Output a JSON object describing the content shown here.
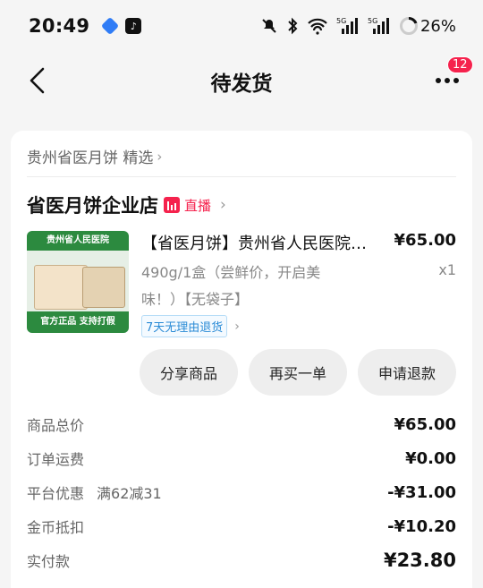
{
  "status_bar": {
    "time": "20:49",
    "battery": "26%"
  },
  "nav": {
    "title": "待发货",
    "badge": "12"
  },
  "order": {
    "breadcrumb": "贵州省医月饼 精选",
    "shop_name": "省医月饼企业店",
    "live_label": "直播",
    "product": {
      "title": "【省医月饼】贵州省人民医院…",
      "price": "¥65.00",
      "spec": "490g/1盒（尝鲜价，开启美味！）【无袋子】",
      "qty": "x1",
      "tag": "7天无理由退货",
      "thumb_top": "贵州省人民医院",
      "thumb_bottom": "官方正品 支持打假"
    },
    "actions": [
      "分享商品",
      "再买一单",
      "申请退款"
    ]
  },
  "summary": {
    "rows": [
      {
        "label": "商品总价",
        "note": "",
        "value": "¥65.00"
      },
      {
        "label": "订单运费",
        "note": "",
        "value": "¥0.00"
      },
      {
        "label": "平台优惠",
        "note": "满62减31",
        "value": "-¥31.00"
      },
      {
        "label": "金币抵扣",
        "note": "",
        "value": "-¥10.20"
      },
      {
        "label": "实付款",
        "note": "",
        "value": "¥23.80"
      }
    ]
  },
  "colors": {
    "accent_red": "#f5224d",
    "tag_blue": "#2a8bd6"
  }
}
